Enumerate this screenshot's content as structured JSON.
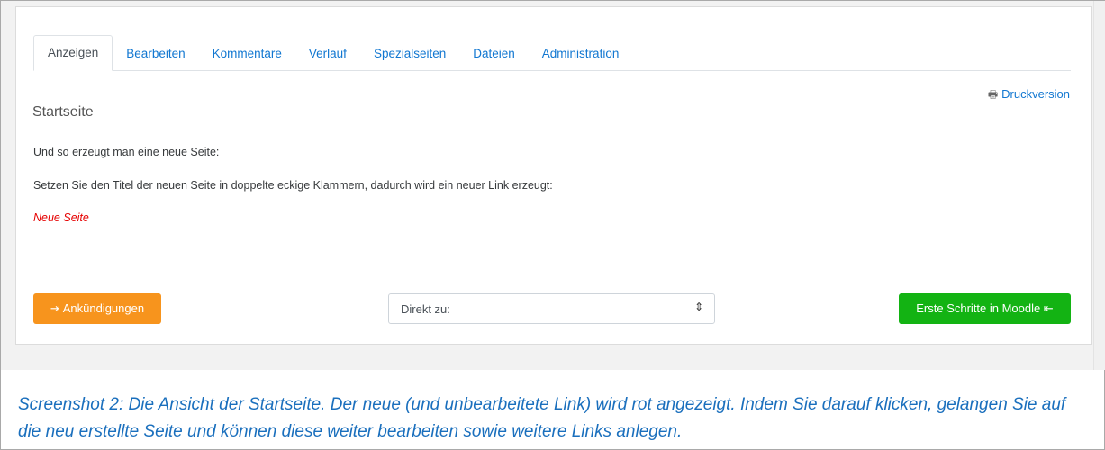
{
  "tabs": [
    {
      "label": "Anzeigen",
      "active": true
    },
    {
      "label": "Bearbeiten",
      "active": false
    },
    {
      "label": "Kommentare",
      "active": false
    },
    {
      "label": "Verlauf",
      "active": false
    },
    {
      "label": "Spezialseiten",
      "active": false
    },
    {
      "label": "Dateien",
      "active": false
    },
    {
      "label": "Administration",
      "active": false
    }
  ],
  "print_link": {
    "icon": "printer-icon",
    "label": "Druckversion"
  },
  "page_title": "Startseite",
  "content": {
    "paragraph1": "Und so erzeugt man eine neue Seite:",
    "paragraph2": "Setzen Sie den Titel der neuen Seite in doppelte eckige Klammern, dadurch wird ein neuer Link erzeugt:",
    "new_link": "Neue Seite"
  },
  "navigation": {
    "prev_label": "⇥ Ankündigungen",
    "jump_label": "Direkt zu:",
    "next_label": "Erste Schritte in Moodle ⇤"
  },
  "caption": "Screenshot 2: Die Ansicht der Startseite. Der neue (und unbearbeitete Link) wird rot angezeigt. Indem Sie darauf klicken, gelangen Sie auf die neu erstellte Seite und können diese weiter bearbeiten sowie weitere Links anlegen.",
  "colors": {
    "link": "#1177d1",
    "new_link": "#e60000",
    "prev_button": "#f7941d",
    "next_button": "#13b313",
    "caption": "#1a6fbd"
  }
}
